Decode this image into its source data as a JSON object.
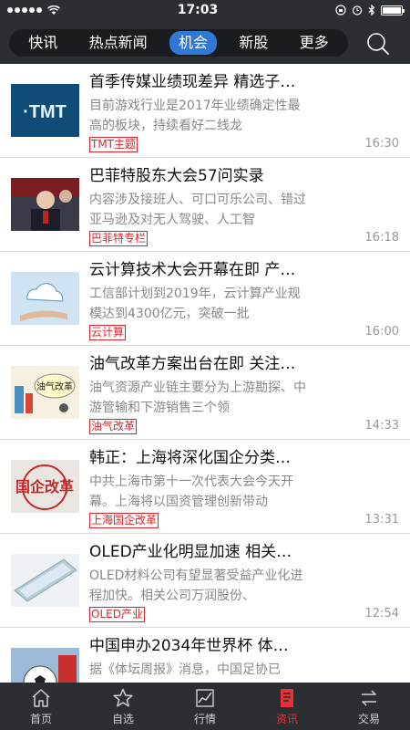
{
  "status": {
    "time": "17:03"
  },
  "tabs": [
    {
      "label": "快讯"
    },
    {
      "label": "热点新闻"
    },
    {
      "label": "机会"
    },
    {
      "label": "新股"
    },
    {
      "label": "更多"
    }
  ],
  "active_tab": "机会",
  "news": [
    {
      "title": "首季传媒业绩现差异 精选子…",
      "summary": "目前游戏行业是2017年业绩确定性最高的板块，持续看好二线龙",
      "tag": "TMT主题",
      "time": "16:30",
      "thumb": "tmt"
    },
    {
      "title": "巴菲特股东大会57问实录",
      "summary": "内容涉及接班人、可口可乐公司、错过亚马逊及对无人驾驶、人工智",
      "tag": "巴菲特专栏",
      "time": "16:18",
      "thumb": "buffett"
    },
    {
      "title": "云计算技术大会开幕在即 产…",
      "summary": "工信部计划到2019年，云计算产业规模达到4300亿元，突破一批",
      "tag": "云计算",
      "time": "16:00",
      "thumb": "cloud"
    },
    {
      "title": "油气改革方案出台在即 关注…",
      "summary": "油气资源产业链主要分为上游勘探、中游管输和下游销售三个领",
      "tag": "油气改革",
      "time": "14:33",
      "thumb": "oil",
      "thumb_text": "油气改革"
    },
    {
      "title": "韩正：上海将深化国企分类…",
      "summary": "中共上海市第十一次代表大会今天开幕。上海将以国资管理创新带动",
      "tag": "上海国企改革",
      "time": "13:31",
      "thumb": "soe",
      "thumb_text": "国企改革"
    },
    {
      "title": "OLED产业化明显加速 相关…",
      "summary": "OLED材料公司有望显著受益产业化进程加快。相关公司万润股份、",
      "tag": "OLED产业",
      "time": "12:54",
      "thumb": "oled"
    },
    {
      "title": "中国申办2034年世界杯 体…",
      "summary": "据《体坛周报》消息，中国足协已",
      "tag": "",
      "time": "",
      "thumb": "football"
    }
  ],
  "bottom_nav": [
    {
      "label": "首页",
      "icon": "home-icon"
    },
    {
      "label": "自选",
      "icon": "star-icon"
    },
    {
      "label": "行情",
      "icon": "chart-icon"
    },
    {
      "label": "资讯",
      "icon": "news-icon"
    },
    {
      "label": "交易",
      "icon": "exchange-icon"
    }
  ],
  "active_bottom": "资讯",
  "colors": {
    "header_bg": "#2b2e33",
    "accent_blue": "#2f78d6",
    "accent_red": "#d9252b"
  }
}
